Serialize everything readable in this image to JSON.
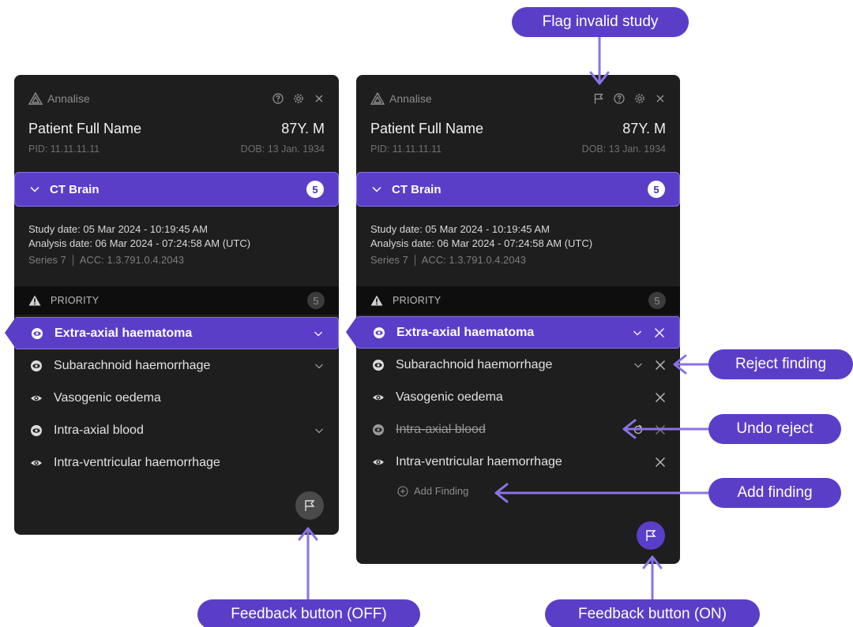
{
  "callouts": {
    "flag_invalid": "Flag invalid study",
    "reject_finding": "Reject finding",
    "undo_reject": "Undo reject",
    "add_finding": "Add finding",
    "feedback_off": "Feedback button (OFF)",
    "feedback_on": "Feedback button (ON)"
  },
  "colors": {
    "accent": "#5b3ec8",
    "panel_bg": "#1e1e1e",
    "arrow": "#8a73e6"
  },
  "left_panel": {
    "brand": "Annalise",
    "patient_name": "Patient Full Name",
    "age_sex": "87Y. M",
    "pid": "PID: 11.11.11.11",
    "dob": "DOB: 13 Jan. 1934",
    "study_title": "CT Brain",
    "study_count": "5",
    "study_date": "Study date: 05 Mar 2024 - 10:19:45 AM",
    "analysis_date": "Analysis date: 06 Mar 2024 - 07:24:58 AM (UTC)",
    "series": "Series 7",
    "acc": "ACC: 1.3.791.0.4.2043",
    "priority_label": "PRIORITY",
    "priority_count": "5",
    "findings": [
      {
        "label": "Extra-axial haematoma",
        "icon": "eye-filled-icon",
        "has_chevron": true
      },
      {
        "label": "Subarachnoid haemorrhage",
        "icon": "eye-filled-icon",
        "has_chevron": true
      },
      {
        "label": "Vasogenic oedema",
        "icon": "eye-icon",
        "has_chevron": false
      },
      {
        "label": "Intra-axial blood",
        "icon": "eye-filled-icon",
        "has_chevron": true
      },
      {
        "label": "Intra-ventricular haemorrhage",
        "icon": "eye-icon",
        "has_chevron": false
      }
    ]
  },
  "right_panel": {
    "brand": "Annalise",
    "patient_name": "Patient Full Name",
    "age_sex": "87Y. M",
    "pid": "PID: 11.11.11.11",
    "dob": "DOB: 13 Jan. 1934",
    "study_title": "CT Brain",
    "study_count": "5",
    "study_date": "Study date: 05 Mar 2024 - 10:19:45 AM",
    "analysis_date": "Analysis date: 06 Mar 2024 - 07:24:58 AM (UTC)",
    "series": "Series 7",
    "acc": "ACC: 1.3.791.0.4.2043",
    "priority_label": "PRIORITY",
    "priority_count": "5",
    "findings": [
      {
        "label": "Extra-axial haematoma",
        "icon": "eye-filled-icon",
        "has_chevron": true
      },
      {
        "label": "Subarachnoid haemorrhage",
        "icon": "eye-filled-icon",
        "has_chevron": true
      },
      {
        "label": "Vasogenic oedema",
        "icon": "eye-icon",
        "has_chevron": false
      },
      {
        "label": "Intra-axial blood",
        "icon": "eye-filled-icon",
        "rejected": true
      },
      {
        "label": "Intra-ventricular haemorrhage",
        "icon": "eye-icon",
        "has_chevron": false
      }
    ],
    "add_finding": "Add Finding"
  }
}
